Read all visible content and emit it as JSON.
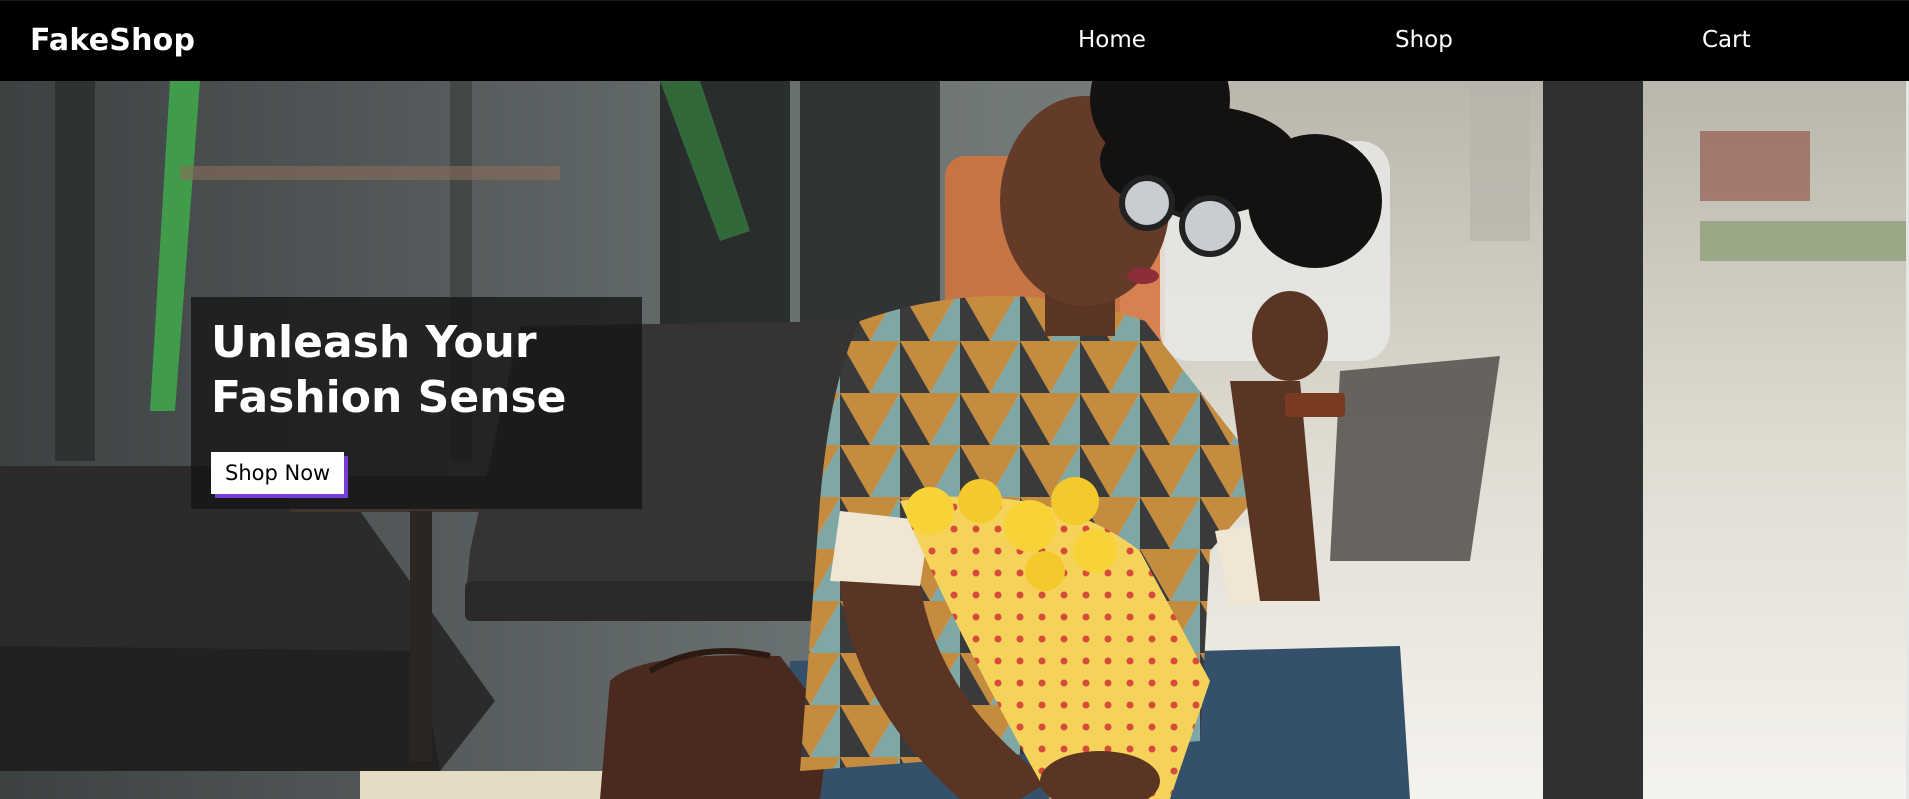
{
  "navbar": {
    "brand": "FakeShop",
    "links": [
      {
        "label": "Home"
      },
      {
        "label": "Shop"
      },
      {
        "label": "Cart"
      }
    ]
  },
  "hero": {
    "title": "Unleash Your Fashion Sense",
    "cta_label": "Shop Now",
    "image_subject": "hero-model-photo"
  },
  "colors": {
    "navbar_bg": "#000000",
    "text_light": "#ffffff",
    "card_bg": "#141414",
    "button_bg": "#ffffff",
    "button_accent": "#7a3cd6"
  }
}
